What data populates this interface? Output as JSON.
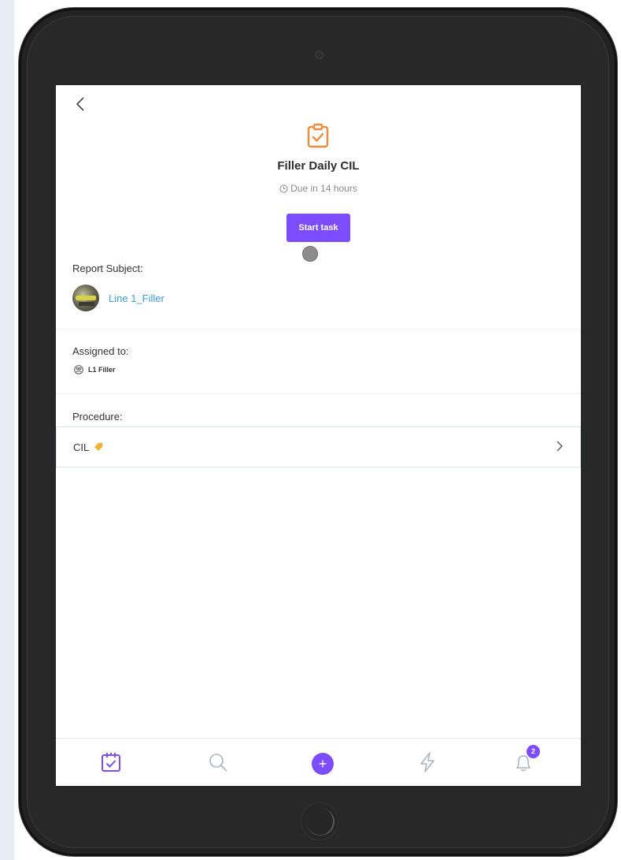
{
  "task": {
    "title": "Filler Daily CIL",
    "due": "Due in 14 hours",
    "start_label": "Start task"
  },
  "report_subject": {
    "label": "Report Subject:",
    "name": "Line 1_Filler"
  },
  "assigned": {
    "label": "Assigned to:",
    "name": "L1 Filler"
  },
  "procedure": {
    "label": "Procedure:",
    "name": "CIL"
  },
  "nav": {
    "items": [
      "calendar-check-icon",
      "search-icon",
      "add-icon",
      "lightning-icon",
      "bell-icon"
    ],
    "notification_count": "2"
  },
  "colors": {
    "accent": "#7c4dff",
    "task_icon": "#f08a3c",
    "link": "#3f9be0",
    "tag": "#f3b13a"
  }
}
